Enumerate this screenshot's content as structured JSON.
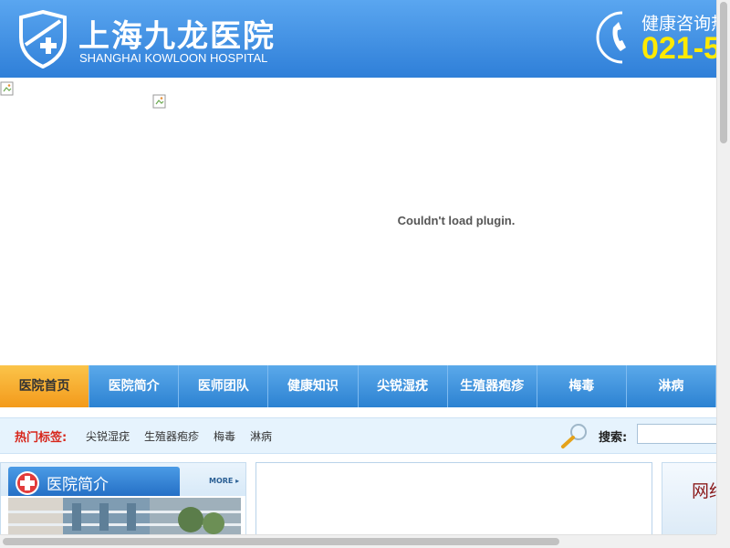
{
  "header": {
    "title_cn": "上海九龙医院",
    "title_en": "SHANGHAI KOWLOON HOSPITAL",
    "consult_label": "健康咨询热",
    "phone_number": "021-5",
    "logo_icon": "hospital-shield-cross-icon",
    "phone_icon": "telephone-icon",
    "colors": {
      "header_bg": "#3b8de0",
      "phone_number": "#ffea00"
    }
  },
  "banner": {
    "plugin_message": "Couldn't load plugin.",
    "broken_image_icon": "broken-image-icon"
  },
  "nav": {
    "items": [
      {
        "label": "医院首页",
        "active": true
      },
      {
        "label": "医院简介"
      },
      {
        "label": "医师团队"
      },
      {
        "label": "健康知识"
      },
      {
        "label": "尖锐湿疣"
      },
      {
        "label": "生殖器疱疹"
      },
      {
        "label": "梅毒"
      },
      {
        "label": "淋病"
      }
    ],
    "colors": {
      "active_bg": "#f7ae2e",
      "bg": "#3a8ddc"
    }
  },
  "tags": {
    "label": "热门标签:",
    "items": [
      "尖锐湿疣",
      "生殖器疱疹",
      "梅毒",
      "淋病"
    ],
    "label_color": "#d7261b"
  },
  "search": {
    "label": "搜索:",
    "value": "",
    "icon": "magnifier-icon"
  },
  "intro": {
    "title": "医院简介",
    "more_label": "MORE ▸",
    "icon": "red-cross-icon"
  },
  "right_panel": {
    "title": "网络"
  }
}
